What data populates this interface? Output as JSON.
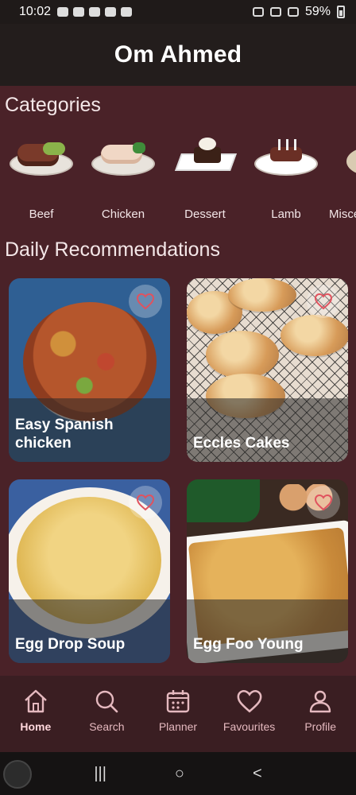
{
  "status_bar": {
    "time": "10:02",
    "battery": "59%"
  },
  "app": {
    "title": "Om Ahmed"
  },
  "sections": {
    "categories_title": "Categories",
    "recommendations_title": "Daily Recommendations"
  },
  "categories": [
    {
      "label": "Beef"
    },
    {
      "label": "Chicken"
    },
    {
      "label": "Dessert"
    },
    {
      "label": "Lamb"
    },
    {
      "label": "Misce"
    }
  ],
  "recommendations": [
    {
      "title": "Easy Spanish chicken"
    },
    {
      "title": "Eccles Cakes"
    },
    {
      "title": "Egg Drop Soup"
    },
    {
      "title": "Egg Foo Young"
    }
  ],
  "bottom_nav": {
    "items": [
      {
        "label": "Home",
        "icon": "home-icon"
      },
      {
        "label": "Search",
        "icon": "search-icon"
      },
      {
        "label": "Planner",
        "icon": "calendar-icon"
      },
      {
        "label": "Favourites",
        "icon": "heart-icon"
      },
      {
        "label": "Profile",
        "icon": "profile-icon"
      }
    ]
  },
  "system_nav": {
    "recents": "|||",
    "home": "○",
    "back": "<"
  },
  "colors": {
    "background": "#4a2228",
    "header": "#231d1c",
    "nav": "#3a1e22",
    "accent": "#e0525e"
  }
}
